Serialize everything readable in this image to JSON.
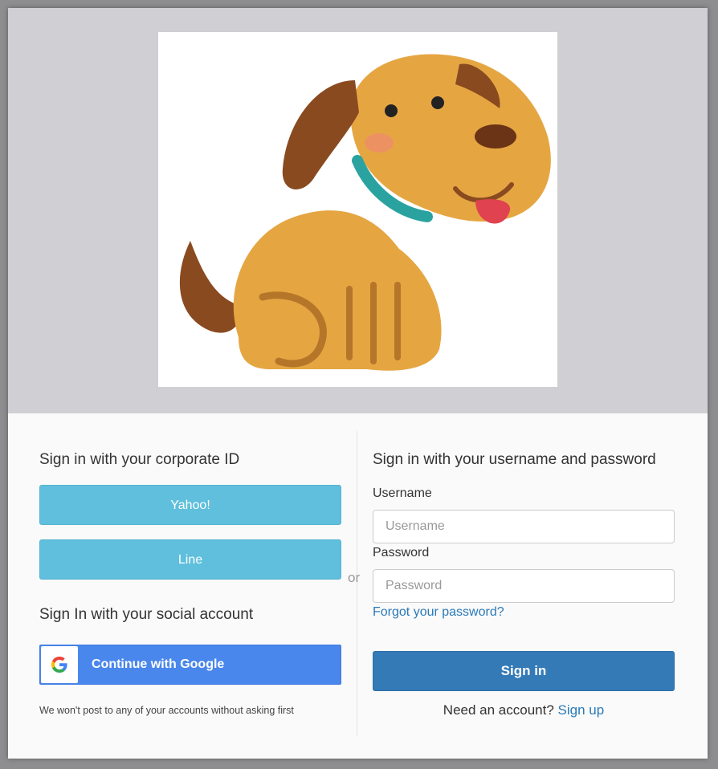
{
  "logo": {
    "icon": "dog-illustration-icon"
  },
  "corporate": {
    "heading": "Sign in with your corporate ID",
    "providers": [
      {
        "label": "Yahoo!"
      },
      {
        "label": "Line"
      }
    ]
  },
  "separator": {
    "text": "or"
  },
  "social": {
    "heading": "Sign In with your social account",
    "google_label": "Continue with Google",
    "google_icon": "google-g-icon",
    "disclaimer": "We won't post to any of your accounts without asking first"
  },
  "credentials": {
    "heading": "Sign in with your username and password",
    "username_label": "Username",
    "username_placeholder": "Username",
    "username_value": "",
    "password_label": "Password",
    "password_placeholder": "Password",
    "password_value": "",
    "forgot_link": "Forgot your password?",
    "signin_label": "Sign in",
    "signup_prompt": "Need an account?",
    "signup_link": "Sign up"
  },
  "colors": {
    "banner": "#d0cfd3",
    "idp_button": "#5fbfdc",
    "google_button": "#4a87ec",
    "signin_button": "#337ab7",
    "link": "#2a7ab8"
  }
}
